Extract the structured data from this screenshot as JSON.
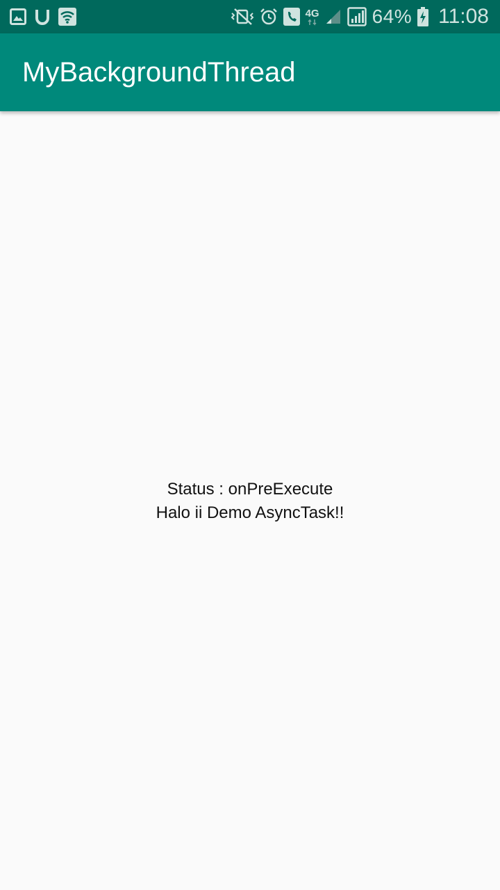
{
  "status_bar": {
    "left_icons": [
      "gallery-icon",
      "u-app-icon",
      "wifi-icon"
    ],
    "right_icons": [
      "vibrate-icon",
      "alarm-icon",
      "call-icon",
      "network-4g-icon",
      "signal-weak-icon",
      "signal-full-icon"
    ],
    "battery_percent": "64%",
    "time": "11:08",
    "network_label": "4G",
    "background_color": "#00695c"
  },
  "app_bar": {
    "title": "MyBackgroundThread",
    "background_color": "#00897b"
  },
  "main": {
    "status_line": "Status : onPreExecute",
    "message_line": "Halo ii Demo AsyncTask!!"
  }
}
